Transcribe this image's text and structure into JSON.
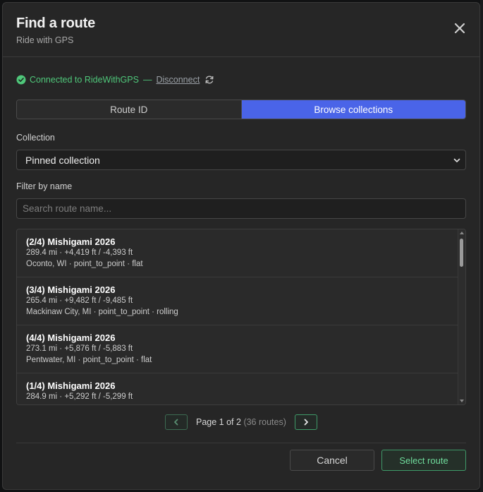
{
  "dialog": {
    "title": "Find a route",
    "subtitle": "Ride with GPS",
    "close_icon": "close-icon"
  },
  "status": {
    "connected_text": "Connected to RideWithGPS",
    "separator": "—",
    "disconnect_label": "Disconnect",
    "status_color": "#4fc77a",
    "icons": [
      "check-circle-icon",
      "refresh-icon"
    ]
  },
  "tabs": [
    {
      "label": "Route ID",
      "active": false
    },
    {
      "label": "Browse collections",
      "active": true
    }
  ],
  "accent_color": "#4a64e8",
  "collection": {
    "label": "Collection",
    "selected": "Pinned collection"
  },
  "filter": {
    "label": "Filter by name",
    "placeholder": "Search route name...",
    "value": ""
  },
  "routes": [
    {
      "name": "(2/4) Mishigami 2026",
      "stats": "289.4 mi · +4,419 ft / -4,393 ft",
      "meta": "Oconto, WI · point_to_point · flat"
    },
    {
      "name": "(3/4) Mishigami 2026",
      "stats": "265.4 mi · +9,482 ft / -9,485 ft",
      "meta": "Mackinaw City, MI · point_to_point · rolling"
    },
    {
      "name": "(4/4) Mishigami 2026",
      "stats": "273.1 mi · +5,876 ft / -5,883 ft",
      "meta": "Pentwater, MI · point_to_point · flat"
    },
    {
      "name": "(1/4) Mishigami 2026",
      "stats": "284.9 mi · +5,292 ft / -5,299 ft",
      "meta": ""
    }
  ],
  "pagination": {
    "page_text": "Page 1 of 2",
    "count_text": "(36 routes)",
    "icons": [
      "chevron-left-icon",
      "chevron-right-icon"
    ]
  },
  "footer": {
    "cancel_label": "Cancel",
    "select_label": "Select route",
    "select_color": "#6fdc9c"
  }
}
